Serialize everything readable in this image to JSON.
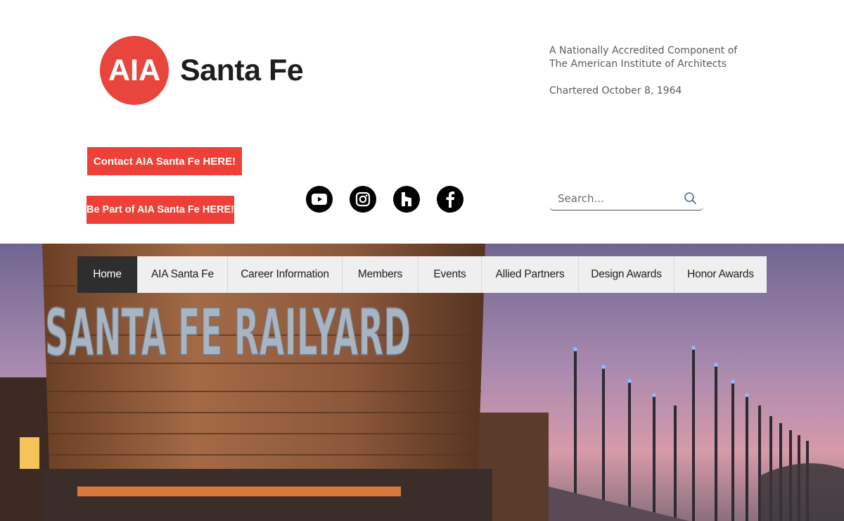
{
  "header": {
    "logo_mark": "AIA",
    "logo_text": "Santa Fe",
    "tagline_line1": "A Nationally Accredited Component of",
    "tagline_line2": "The American Institute of Architects",
    "chartered": "Chartered October 8, 1964"
  },
  "buttons": {
    "contact": "Contact AIA Santa Fe HERE!",
    "be_part": "Be Part of AIA Santa Fe HERE!"
  },
  "social": [
    "youtube-icon",
    "instagram-icon",
    "houzz-icon",
    "facebook-icon"
  ],
  "search": {
    "placeholder": "Search..."
  },
  "nav": {
    "items": [
      {
        "label": "Home"
      },
      {
        "label": "AIA Santa Fe"
      },
      {
        "label": "Career Information"
      },
      {
        "label": "Members"
      },
      {
        "label": "Events"
      },
      {
        "label": "Allied Partners"
      },
      {
        "label": "Design Awards"
      },
      {
        "label": "Honor Awards"
      }
    ]
  },
  "hero": {
    "sign_text": "SANTA FE RAILYARD"
  },
  "colors": {
    "accent": "#ee4036",
    "nav_active": "#2e2e2e",
    "nav_bg": "#efefef"
  }
}
